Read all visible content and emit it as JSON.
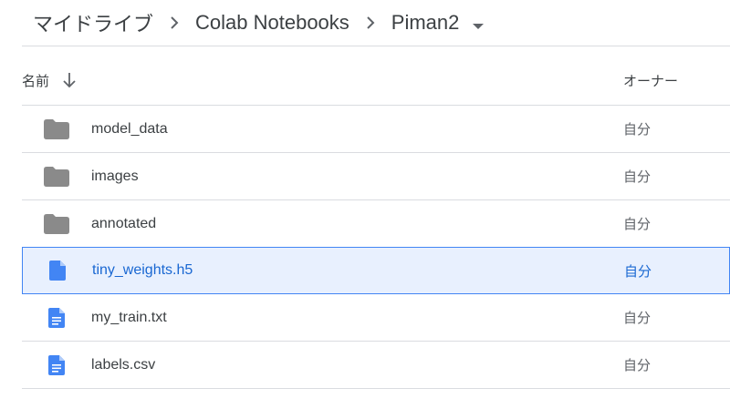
{
  "breadcrumb": {
    "items": [
      "マイドライブ",
      "Colab Notebooks",
      "Piman2"
    ],
    "separator": ">"
  },
  "header": {
    "name_label": "名前",
    "owner_label": "オーナー"
  },
  "files": [
    {
      "name": "model_data",
      "type": "folder",
      "owner": "自分"
    },
    {
      "name": "images",
      "type": "folder",
      "owner": "自分"
    },
    {
      "name": "annotated",
      "type": "folder",
      "owner": "自分"
    },
    {
      "name": "tiny_weights.h5",
      "type": "file",
      "owner": "自分",
      "selected": true
    },
    {
      "name": "my_train.txt",
      "type": "doc",
      "owner": "自分"
    },
    {
      "name": "labels.csv",
      "type": "doc",
      "owner": "自分"
    }
  ],
  "colors": {
    "folder": "#8a8a8a",
    "file_blue": "#4285f4",
    "selected_bg": "#e8f0fe",
    "selected_text": "#1967d2"
  }
}
